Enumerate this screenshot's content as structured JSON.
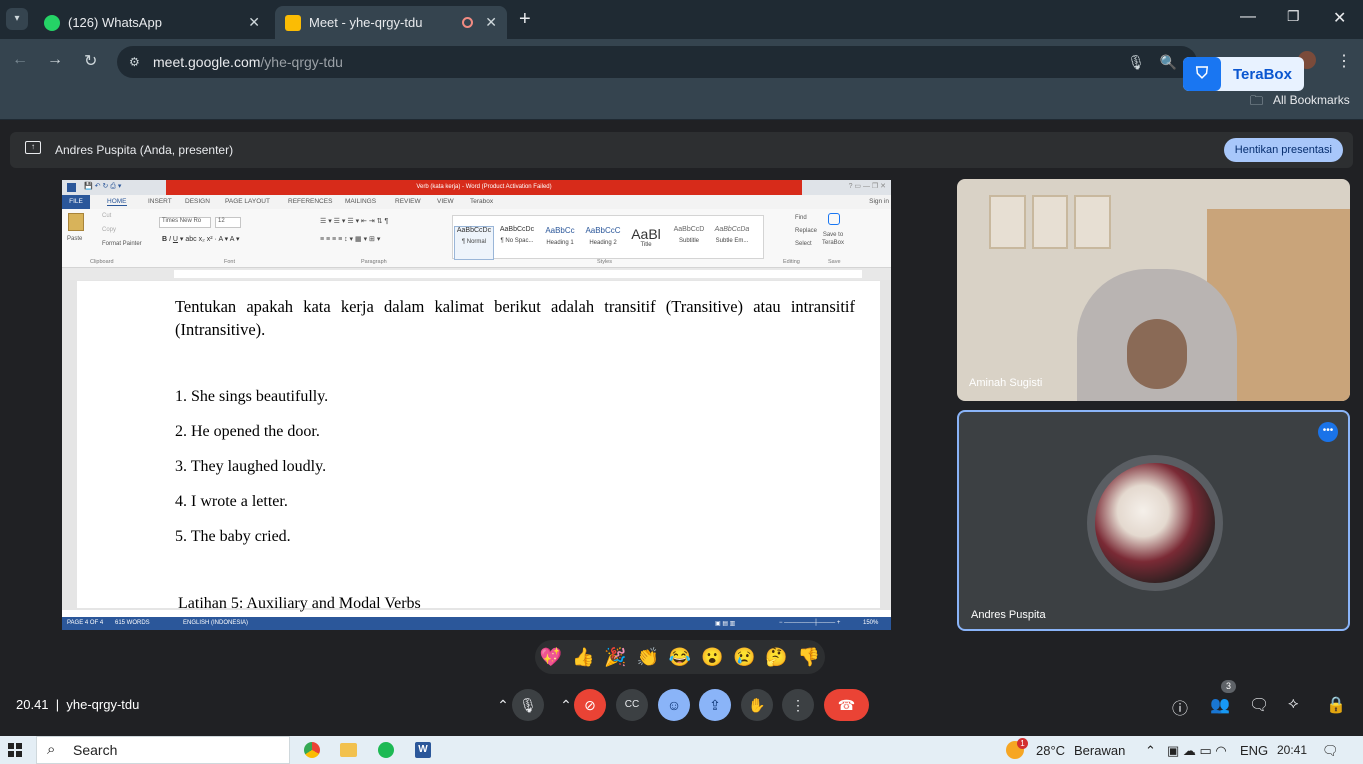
{
  "browser": {
    "tabs": [
      {
        "title": "(126) WhatsApp",
        "favicon_color": "#25d366"
      },
      {
        "title": "Meet - yhe-qrgy-tdu",
        "favicon_color": "#fbbc04"
      }
    ],
    "url_host": "meet.google.com",
    "url_path": "/yhe-qrgy-tdu",
    "terabox_label": "TeraBox",
    "all_bookmarks": "All Bookmarks"
  },
  "presentation": {
    "presenter_label": "Andres Puspita (Anda, presenter)",
    "stop_label": "Hentikan presentasi"
  },
  "word": {
    "title": "Verb (kata kerja) - Word (Product Activation Failed)",
    "tabs": [
      "FILE",
      "HOME",
      "INSERT",
      "DESIGN",
      "PAGE LAYOUT",
      "REFERENCES",
      "MAILINGS",
      "REVIEW",
      "VIEW",
      "Terabox"
    ],
    "sign_in": "Sign in",
    "font_name": "Times New Ro",
    "font_size": "12",
    "styles": [
      {
        "preview": "AaBbCcDc",
        "name": "¶ Normal"
      },
      {
        "preview": "AaBbCcDc",
        "name": "¶ No Spac..."
      },
      {
        "preview": "AaBbCc",
        "name": "Heading 1"
      },
      {
        "preview": "AaBbCcC",
        "name": "Heading 2"
      },
      {
        "preview": "AaBl",
        "name": "Title"
      },
      {
        "preview": "AaBbCcD",
        "name": "Subtitle"
      },
      {
        "preview": "AaBbCcDa",
        "name": "Subtle Em..."
      }
    ],
    "group_labels": [
      "Clipboard",
      "Font",
      "Paragraph",
      "Styles",
      "Editing",
      "Save"
    ],
    "clipboard": {
      "paste": "Paste",
      "cut": "Cut",
      "copy": "Copy",
      "painter": "Format Painter"
    },
    "editing": {
      "find": "Find",
      "replace": "Replace",
      "select": "Select"
    },
    "save_to": "Save to TeraBox",
    "instruction": "Tentukan apakah kata kerja dalam kalimat berikut adalah transitif (Transitive) atau intransitif (Intransitive).",
    "items": [
      "1. She sings beautifully.",
      "2. He opened the door.",
      "3. They laughed loudly.",
      "4. I wrote a letter.",
      "5. The baby cried."
    ],
    "next_heading": "Latihan 5: Auxiliary and Modal Verbs",
    "status": {
      "page": "PAGE 4 OF 4",
      "words": "615 WORDS",
      "language": "ENGLISH (INDONESIA)",
      "zoom": "150%"
    }
  },
  "participants": [
    {
      "name": "Aminah Sugisti"
    },
    {
      "name": "Andres Puspita"
    }
  ],
  "reactions": [
    "💖",
    "👍",
    "🎉",
    "👏",
    "😂",
    "😮",
    "😢",
    "🤔",
    "👎"
  ],
  "meeting": {
    "time": "20.41",
    "code": "yhe-qrgy-tdu",
    "people_count": "3"
  },
  "taskbar": {
    "search": "Search",
    "weather": "28°C",
    "weather_text": "Berawan",
    "lang": "ENG",
    "clock": "20:41",
    "notify_count": "1"
  }
}
